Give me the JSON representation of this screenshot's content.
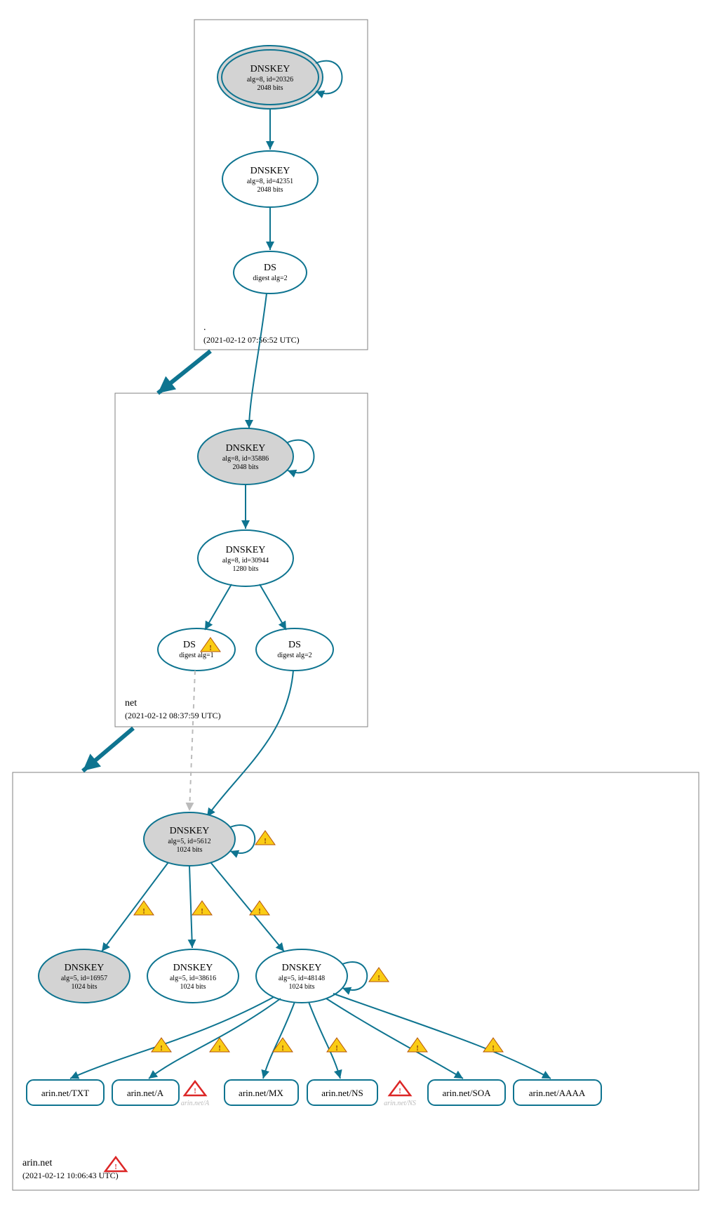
{
  "colors": {
    "teal": "#0e7490",
    "grey_fill": "#d3d3d3"
  },
  "zones": {
    "root": {
      "name": ".",
      "timestamp": "(2021-02-12 07:56:52 UTC)"
    },
    "net": {
      "name": "net",
      "timestamp": "(2021-02-12 08:37:59 UTC)"
    },
    "arin": {
      "name": "arin.net",
      "timestamp": "(2021-02-12 10:06:43 UTC)"
    }
  },
  "nodes": {
    "root_ksk": {
      "title": "DNSKEY",
      "line1": "alg=8, id=20326",
      "line2": "2048 bits"
    },
    "root_zsk": {
      "title": "DNSKEY",
      "line1": "alg=8, id=42351",
      "line2": "2048 bits"
    },
    "root_ds": {
      "title": "DS",
      "line1": "digest alg=2"
    },
    "net_ksk": {
      "title": "DNSKEY",
      "line1": "alg=8, id=35886",
      "line2": "2048 bits"
    },
    "net_zsk": {
      "title": "DNSKEY",
      "line1": "alg=8, id=30944",
      "line2": "1280 bits"
    },
    "net_ds1": {
      "title": "DS",
      "line1": "digest alg=1"
    },
    "net_ds2": {
      "title": "DS",
      "line1": "digest alg=2"
    },
    "arin_ksk": {
      "title": "DNSKEY",
      "line1": "alg=5, id=5612",
      "line2": "1024 bits"
    },
    "arin_k1": {
      "title": "DNSKEY",
      "line1": "alg=5, id=16957",
      "line2": "1024 bits"
    },
    "arin_k2": {
      "title": "DNSKEY",
      "line1": "alg=5, id=38616",
      "line2": "1024 bits"
    },
    "arin_k3": {
      "title": "DNSKEY",
      "line1": "alg=5, id=48148",
      "line2": "1024 bits"
    },
    "rr_txt": {
      "label": "arin.net/TXT"
    },
    "rr_a": {
      "label": "arin.net/A"
    },
    "rr_mx": {
      "label": "arin.net/MX"
    },
    "rr_ns": {
      "label": "arin.net/NS"
    },
    "rr_soa": {
      "label": "arin.net/SOA"
    },
    "rr_aaaa": {
      "label": "arin.net/AAAA"
    },
    "ghost_a": {
      "label": "arin.net/A"
    },
    "ghost_ns": {
      "label": "arin.net/NS"
    }
  }
}
